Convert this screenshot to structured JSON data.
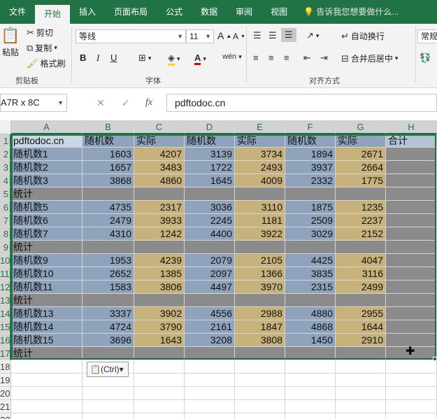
{
  "ribbon_tabs": [
    "文件",
    "开始",
    "插入",
    "页面布局",
    "公式",
    "数据",
    "审阅",
    "视图"
  ],
  "tell_me": "告诉我您想要做什么...",
  "clipboard": {
    "paste": "粘贴",
    "cut": "剪切",
    "copy": "复制",
    "format_painter": "格式刷",
    "group": "剪贴板"
  },
  "font": {
    "name": "等线",
    "size": "11",
    "bold": "B",
    "italic": "I",
    "underline": "U",
    "group": "字体"
  },
  "alignment": {
    "wrap": "自动换行",
    "merge": "合并后居中",
    "group": "对齐方式"
  },
  "number": {
    "format": "常规"
  },
  "name_box": "A7R x 8C",
  "formula": "pdftodoc.cn",
  "columns": [
    "A",
    "B",
    "C",
    "D",
    "E",
    "F",
    "G",
    "H"
  ],
  "rows": [
    "1",
    "2",
    "3",
    "4",
    "5",
    "6",
    "7",
    "8",
    "9",
    "10",
    "11",
    "12",
    "13",
    "14",
    "15",
    "16",
    "17",
    "18",
    "19",
    "20",
    "21",
    "22"
  ],
  "sheet": [
    [
      "pdftodoc.cn",
      "随机数",
      "实际",
      "随机数",
      "实际",
      "随机数",
      "实际",
      "合计"
    ],
    [
      "随机数1",
      "1603",
      "4207",
      "3139",
      "3734",
      "1894",
      "2671",
      ""
    ],
    [
      "随机数2",
      "1657",
      "3483",
      "1722",
      "2493",
      "3937",
      "2664",
      ""
    ],
    [
      "随机数3",
      "3868",
      "4860",
      "1645",
      "4009",
      "2332",
      "1775",
      ""
    ],
    [
      "统计",
      "",
      "",
      "",
      "",
      "",
      "",
      ""
    ],
    [
      "随机数5",
      "4735",
      "2317",
      "3036",
      "3110",
      "1875",
      "1235",
      ""
    ],
    [
      "随机数6",
      "2479",
      "3933",
      "2245",
      "1181",
      "2509",
      "2237",
      ""
    ],
    [
      "随机数7",
      "4310",
      "1242",
      "4400",
      "3922",
      "3029",
      "2152",
      ""
    ],
    [
      "统计",
      "",
      "",
      "",
      "",
      "",
      "",
      ""
    ],
    [
      "随机数9",
      "1953",
      "4239",
      "2079",
      "2105",
      "4425",
      "4047",
      ""
    ],
    [
      "随机数10",
      "2652",
      "1385",
      "2097",
      "1366",
      "3835",
      "3116",
      ""
    ],
    [
      "随机数11",
      "1583",
      "3806",
      "4497",
      "3970",
      "2315",
      "2499",
      ""
    ],
    [
      "统计",
      "",
      "",
      "",
      "",
      "",
      "",
      ""
    ],
    [
      "随机数13",
      "3337",
      "3902",
      "4556",
      "2988",
      "4880",
      "2955",
      ""
    ],
    [
      "随机数14",
      "4724",
      "3790",
      "2161",
      "1847",
      "4868",
      "1644",
      ""
    ],
    [
      "随机数15",
      "3696",
      "1643",
      "3208",
      "3808",
      "1450",
      "2910",
      ""
    ],
    [
      "统计",
      "",
      "",
      "",
      "",
      "",
      "",
      ""
    ]
  ],
  "paste_options": "(Ctrl)",
  "colors": {
    "brand": "#217346",
    "data_blue": "#8fa4bc",
    "data_gold": "#c6b27a",
    "stat_gray": "#8b8b8b",
    "header_row": "#b3c4d7"
  }
}
